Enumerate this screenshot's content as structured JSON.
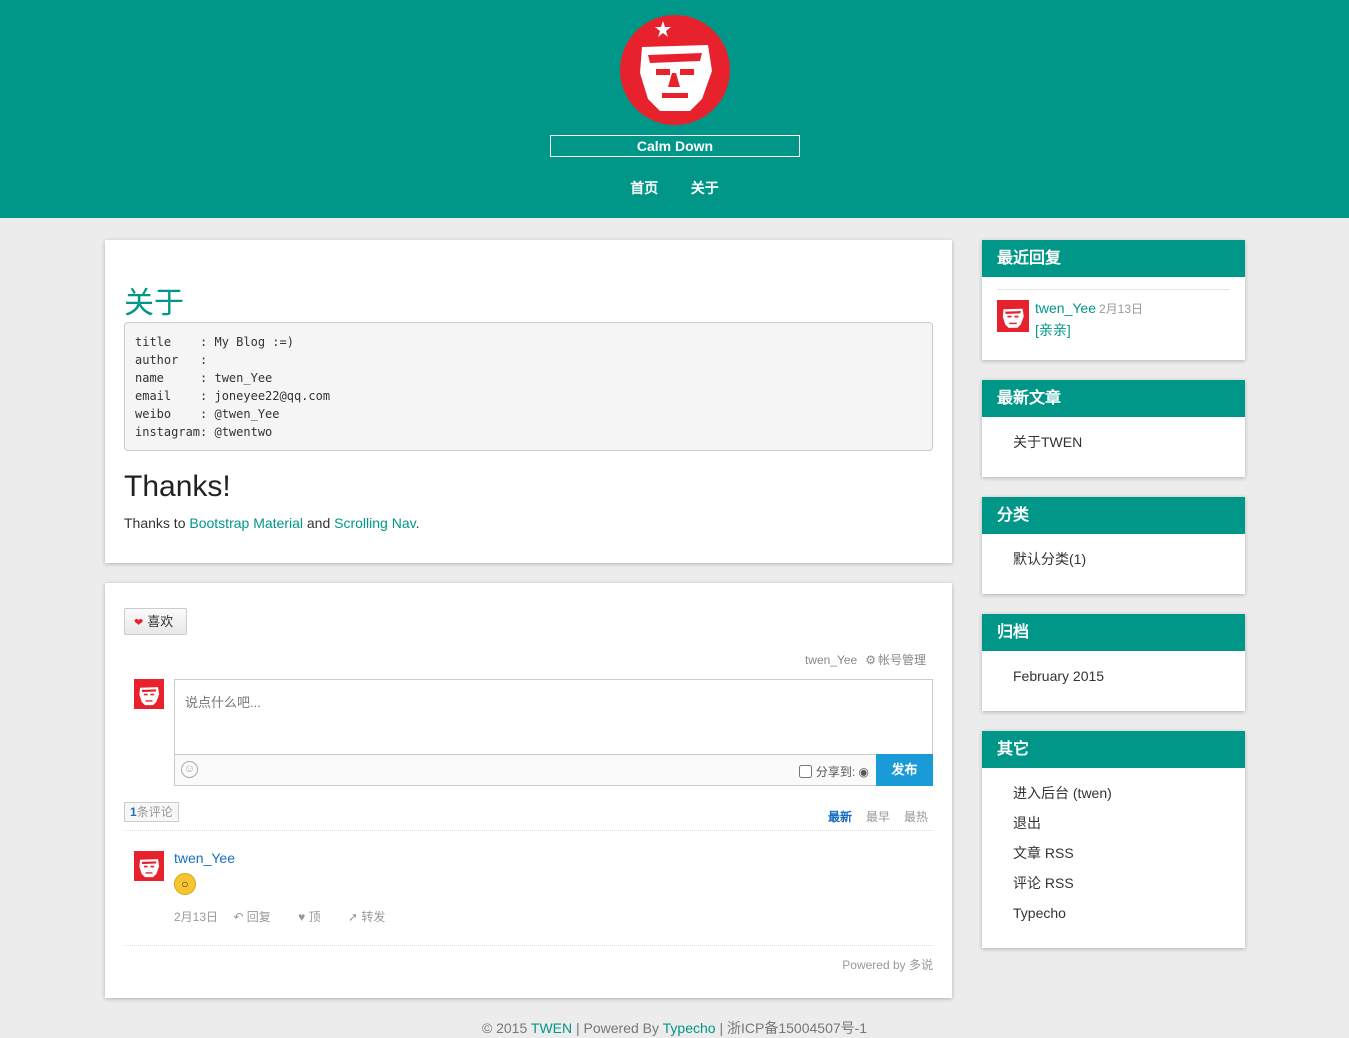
{
  "header": {
    "site_title": "Calm Down",
    "nav": [
      "首页",
      "关于"
    ]
  },
  "post": {
    "title": "关于",
    "code_lines": [
      "title    : My Blog :=)",
      "author   :",
      "name     : twen_Yee",
      "email    : joneyee22@qq.com",
      "weibo    : @twen_Yee",
      "instagram: @twentwo"
    ],
    "thanks_heading": "Thanks!",
    "thanks_prefix": "Thanks to ",
    "link1": "Bootstrap Material",
    "mid": " and ",
    "link2": "Scrolling Nav",
    "suffix": "."
  },
  "comments": {
    "like_label": "喜欢",
    "account_user": "twen_Yee",
    "account_manage": "帐号管理",
    "placeholder": "说点什么吧...",
    "share_label": "分享到:",
    "publish_label": "发布",
    "count_num": "1",
    "count_text": "条评论",
    "sort_newest": "最新",
    "sort_oldest": "最早",
    "sort_hottest": "最热",
    "items": [
      {
        "author": "twen_Yee",
        "date": "2月13日",
        "reply": "回复",
        "up": "顶",
        "forward": "转发"
      }
    ],
    "powered": "Powered by 多说"
  },
  "sidebar": {
    "recent_replies": {
      "title": "最近回复",
      "author": "twen_Yee",
      "date": "2月13日",
      "text": "[亲亲]"
    },
    "latest_posts": {
      "title": "最新文章",
      "items": [
        "关于TWEN"
      ]
    },
    "categories": {
      "title": "分类",
      "items": [
        "默认分类(1)"
      ]
    },
    "archives": {
      "title": "归档",
      "items": [
        "February 2015"
      ]
    },
    "others": {
      "title": "其它",
      "items": [
        "进入后台 (twen)",
        "退出",
        "文章 RSS",
        "评论 RSS",
        "Typecho"
      ]
    }
  },
  "footer": {
    "copyright": "© 2015 ",
    "site": "TWEN",
    "powered_by": " | Powered By ",
    "typecho": "Typecho",
    "icp": " | 浙ICP备15004507号-1"
  },
  "colors": {
    "brand": "#009688",
    "avatar_red": "#e8222c",
    "link_blue": "#1a6ec0",
    "publish_blue": "#1a9ad6"
  }
}
